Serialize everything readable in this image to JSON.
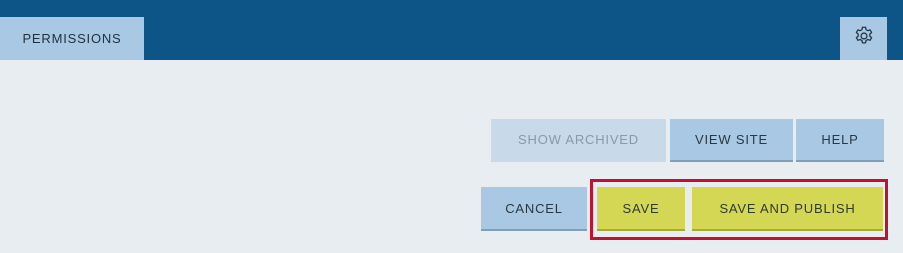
{
  "header": {
    "tab_label": "PERMISSIONS",
    "settings_icon": "gear-icon"
  },
  "toolbar_top": {
    "show_archived_label": "SHOW ARCHIVED",
    "view_site_label": "VIEW SITE",
    "help_label": "HELP"
  },
  "toolbar_bottom": {
    "cancel_label": "CANCEL",
    "save_label": "SAVE",
    "save_publish_label": "SAVE AND PUBLISH"
  },
  "colors": {
    "header_bg": "#0d5587",
    "button_blue": "#a9c8e4",
    "button_disabled": "#c8d9ea",
    "button_yellow": "#d4d754",
    "highlight_red": "#c0112d",
    "page_bg": "#e8edf2"
  }
}
